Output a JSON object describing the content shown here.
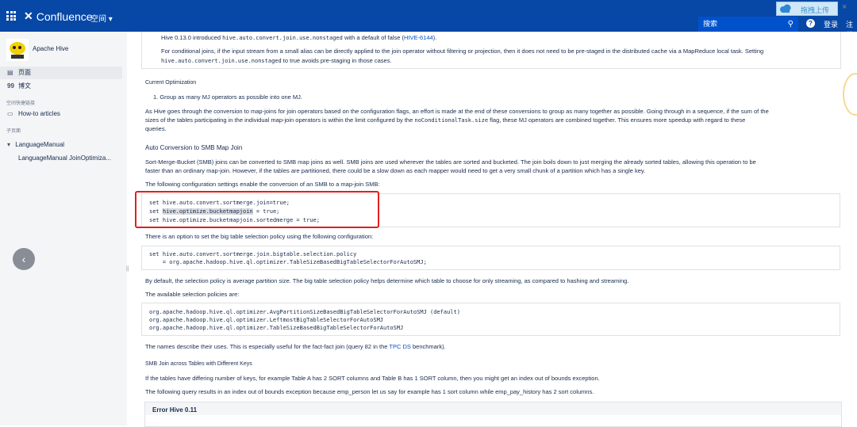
{
  "topbar": {
    "product": "Confluence",
    "space_menu": "空间 ▾",
    "search_placeholder": "搜索",
    "login": "登录",
    "signup": "注册",
    "upload_label": "拖拽上传",
    "close": "×",
    "help": "?"
  },
  "sidebar": {
    "space_name": "Apache Hive",
    "items": [
      {
        "icon": "page-icon",
        "label": "页面"
      },
      {
        "icon": "quote-icon",
        "label": "博文"
      }
    ],
    "shortcuts_label": "空间快捷链接",
    "shortcut": "How-to articles",
    "children_label": "子页面",
    "tree": [
      {
        "label": "LanguageManual"
      },
      {
        "label": "LanguageManual JoinOptimiza..."
      }
    ],
    "back": "‹"
  },
  "content": {
    "note_line1_pre": "Hive 0.13.0 introduced ",
    "note_line1_code": "hive.auto.convert.join.use.nonstaged",
    "note_line1_mid": " with a default of false (",
    "note_line1_link": "HIVE-6144",
    "note_line1_post": ").",
    "note_line2": "For conditional joins, if the input stream from a small alias can be directly applied to the join operator without filtering or projection, then it does not need to be pre-staged in the distributed cache via a MapReduce local task. Setting",
    "note_line3_code": "hive.auto.convert.join.use.nonstaged",
    "note_line3_post": " to true avoids pre-staging in those cases.",
    "current_opt_heading": "Current Optimization",
    "current_opt_item": "1.  Group as many MJ operators as possible into one MJ.",
    "para1_l1": "As Hive goes through the conversion to map-joins for join operators based on the configuration flags, an effort is made at the end of these conversions to group as many together as possible. Going through in a sequence, if the sum of the",
    "para1_l2_pre": "sizes of the tables participating in the individual map-join operators is within the limit configured by the ",
    "para1_l2_code": "noConditionalTask.size",
    "para1_l2_post": " flag, these MJ operators are combined together. This ensures more speedup with regard to these",
    "para1_l3": "queries.",
    "smb_heading": "Auto Conversion to SMB Map Join",
    "smb_l1": "Sort-Merge-Bucket (SMB) joins can be converted to SMB map joins as well. SMB joins are used wherever the tables are sorted and bucketed. The join boils down to just merging the already sorted tables, allowing this operation to be",
    "smb_l2": "faster than an ordinary map-join. However, if the tables are partitioned, there could be a slow down as each mapper would need to get a very small chunk of a partition which has a single key.",
    "smb_l3": "The following configuration settings enable the conversion of an SMB to a map-join SMB:",
    "code1": [
      "set hive.auto.convert.sortmerge.join=true;",
      "set hive.optimize.bucketmapjoin = true;",
      "set hive.optimize.bucketmapjoin.sortedmerge = true;"
    ],
    "code1_l2_pre": "set ",
    "code1_l2_hl": "hive.optimize.bucketmapjoin",
    "code1_l2_post": " = true;",
    "big_table_line": "There is an option to set the big table selection policy using the following configuration:",
    "code2": [
      "set hive.auto.convert.sortmerge.join.bigtable.selection.policy",
      "    = org.apache.hadoop.hive.ql.optimizer.TableSizeBasedBigTableSelectorForAutoSMJ;"
    ],
    "default_policy": "By default, the selection policy is average partition size. The big table selection policy helps determine which table to choose for only streaming, as compared to hashing and streaming.",
    "available_policies": "The available selection policies are:",
    "code3": [
      "org.apache.hadoop.hive.ql.optimizer.AvgPartitionSizeBasedBigTableSelectorForAutoSMJ (default)",
      "org.apache.hadoop.hive.ql.optimizer.LeftmostBigTableSelectorForAutoSMJ",
      "org.apache.hadoop.hive.ql.optimizer.TableSizeBasedBigTableSelectorForAutoSMJ"
    ],
    "names_pre": "The names describe their uses. This is especially useful for the fact-fact join (query 82 in the ",
    "names_link": "TPC DS",
    "names_post": " benchmark).",
    "smb_diff_heading": "SMB Join across Tables with Different Keys",
    "diff_l1": "If the tables have differing number of keys, for example Table A has 2 SORT columns and Table B has 1 SORT column, then you might get an index out of bounds exception.",
    "diff_l2": "The following query results in an index out of bounds exception because emp_person let us say for example has 1 sort column while emp_pay_history has 2 sort columns.",
    "error_panel_title": "Error Hive 0.11"
  }
}
